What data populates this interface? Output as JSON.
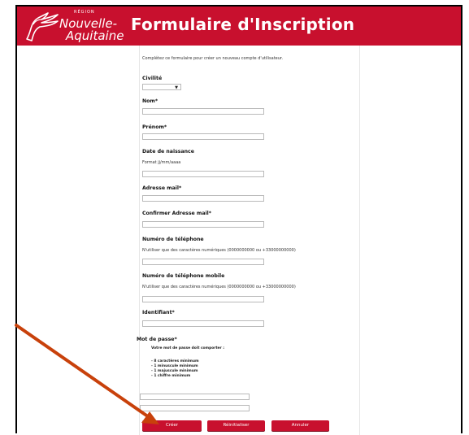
{
  "header": {
    "logo_region": "RÉGION",
    "logo_line1": "Nouvelle-",
    "logo_line2": "Aquitaine",
    "title": "Formulaire d'Inscription"
  },
  "form": {
    "intro": "Complétez ce formulaire pour créer un nouveau compte d'utilisateur.",
    "civilite_label": "Civilité",
    "civilite_value": "",
    "nom_label": "Nom*",
    "prenom_label": "Prénom*",
    "birth_label": "Date de naissance",
    "birth_hint": "Format jj/mm/aaaa",
    "email_label": "Adresse mail*",
    "email_confirm_label": "Confirmer Adresse mail*",
    "phone_label": "Numéro de téléphone",
    "phone_hint": "N'utiliser que des caractères numériques (0000000000 ou +33000000000)",
    "mobile_label": "Numéro de téléphone mobile",
    "mobile_hint": "N'utiliser que des caractères numériques (0000000000 ou +33000000000)",
    "id_label": "Identifiant*",
    "password_label": "Mot de passe*",
    "password_intro": "Votre mot de passe doit comporter :",
    "password_rules": [
      "- 8 caractères minimum",
      "- 1 minuscule minimum",
      "- 1 majuscule minimum",
      "- 1 chiffre minimum"
    ]
  },
  "buttons": {
    "create": "Créer",
    "reset": "Réinitialiser",
    "cancel": "Annuler"
  },
  "colors": {
    "brand": "#c8102e",
    "arrow": "#c8410b"
  },
  "icons": {
    "logo": "lion-emblem-icon",
    "select_caret": "caret-down-icon",
    "annotation": "arrow-annotation-icon"
  }
}
